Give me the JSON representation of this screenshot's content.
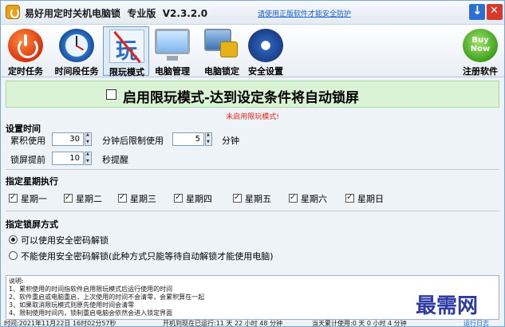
{
  "title": {
    "app_name": "易好用定时关机电脑锁",
    "edition": "专业版",
    "version": "V2.3.2.0",
    "link": "请使用正版软件才能安全防护"
  },
  "toolbar": [
    {
      "name": "tab-scheduled-task",
      "label": "定时任务",
      "icon": "power-icon"
    },
    {
      "name": "tab-period-task",
      "label": "时间段任务",
      "icon": "clock-icon"
    },
    {
      "name": "tab-play-limit",
      "label": "限玩模式",
      "icon": "game-limit-icon",
      "active": true
    },
    {
      "name": "tab-pc-management",
      "label": "电脑管理",
      "icon": "monitor-icon"
    },
    {
      "name": "tab-pc-lock",
      "label": "电脑锁定",
      "icon": "lock-icon"
    },
    {
      "name": "tab-security",
      "label": "安全设置",
      "icon": "gear-icon"
    },
    {
      "name": "tab-register",
      "label": "注册软件",
      "icon": "buy-now-icon"
    }
  ],
  "banner": {
    "checkbox_label": "启用限玩模式-达到设定条件将自动锁屏",
    "status": "未启用限玩模式!"
  },
  "time_settings": {
    "title": "设置时间",
    "accumulate_label": "累积使用",
    "accumulate_value": "30",
    "limit_label": "分钟后限制使用",
    "limit_value": "5",
    "limit_unit": "分钟",
    "advance_label": "锁屏提前",
    "advance_value": "10",
    "advance_unit": "秒提醒"
  },
  "weekdays": {
    "title": "指定星期执行",
    "days": [
      "星期一",
      "星期二",
      "星期三",
      "星期四",
      "星期五",
      "星期六",
      "星期日"
    ]
  },
  "lock_method": {
    "title": "指定锁屏方式",
    "options": [
      {
        "label": "可以使用安全密码解锁",
        "selected": true
      },
      {
        "label": "不能使用安全密码解锁(此种方式只能等待自动解锁才能使用电脑)",
        "selected": false
      }
    ]
  },
  "notes": {
    "lines": [
      "说明:",
      "1、累积使用的时间指软件启用限玩模式后运行使用的时间",
      "2、软件重启或电脑重启，上次使用的时间不会清零，会累积算在一起",
      "3、如果取消限玩模式则原先使用时间会清零",
      "4、限制使用时间内，锁制重启电脑会依然会进入锁定界面"
    ]
  },
  "watermark": "最需网",
  "statusbar": {
    "time": "时间:2021年11月22日 16时02分57秒",
    "uptime": "开机到现在已运行:11 天 22 小时 48 分钟",
    "today": "当天累计使用:0 天 0 小时 4 分钟",
    "log_link": "运行日志"
  }
}
